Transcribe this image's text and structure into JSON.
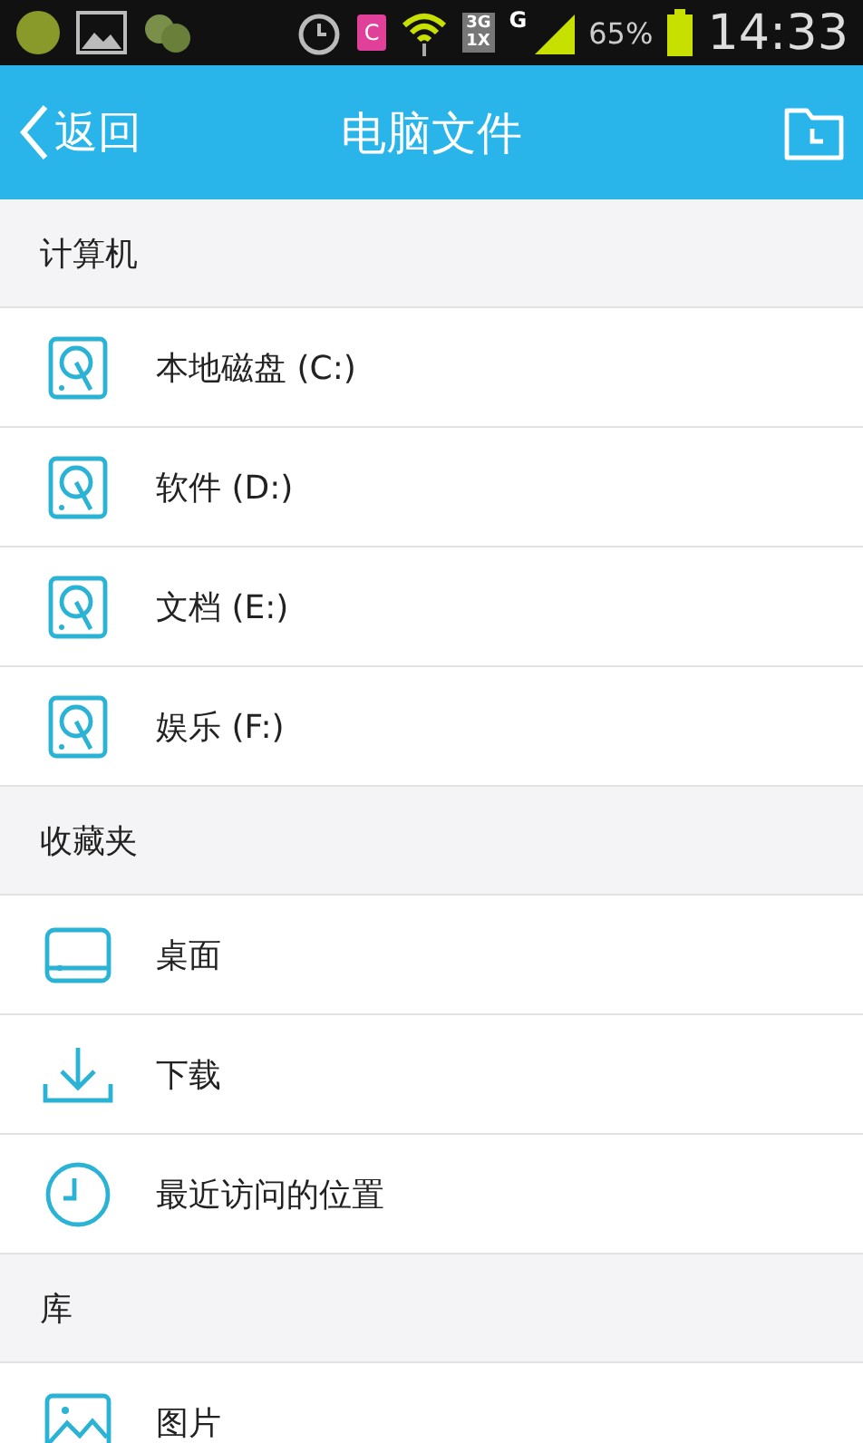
{
  "status_bar": {
    "network_top": "3G",
    "network_bottom": "1X",
    "carrier_type": "G",
    "battery": "65%",
    "time": "14:33",
    "notification_badge": "C"
  },
  "header": {
    "back": "返回",
    "title": "电脑文件"
  },
  "sections": [
    {
      "title": "计算机",
      "items": [
        {
          "kind": "drive",
          "label": "本地磁盘 (C:)"
        },
        {
          "kind": "drive",
          "label": "软件 (D:)"
        },
        {
          "kind": "drive",
          "label": "文档 (E:)"
        },
        {
          "kind": "drive",
          "label": "娱乐 (F:)"
        }
      ]
    },
    {
      "title": "收藏夹",
      "items": [
        {
          "kind": "desktop",
          "label": "桌面"
        },
        {
          "kind": "download",
          "label": "下载"
        },
        {
          "kind": "recent",
          "label": "最近访问的位置"
        }
      ]
    },
    {
      "title": "库",
      "items": [
        {
          "kind": "pictures",
          "label": "图片"
        }
      ]
    }
  ]
}
